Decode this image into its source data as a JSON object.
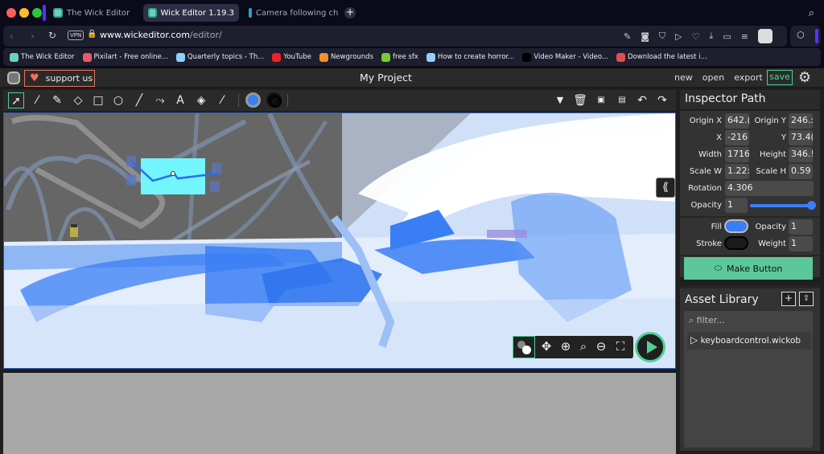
{
  "browser": {
    "tabs": [
      {
        "label": "The Wick Editor",
        "active": false
      },
      {
        "label": "Wick Editor 1.19.3",
        "active": true
      },
      {
        "label": "Camera following charac",
        "active": false
      }
    ],
    "new_tab": "+",
    "vpn_label": "VPN",
    "url_host": "www.wickeditor.com",
    "url_path": "/editor/",
    "bookmarks": [
      {
        "label": "The Wick Editor",
        "color": "#6ad0c0"
      },
      {
        "label": "Pixilart - Free online...",
        "color": "#e85a6a"
      },
      {
        "label": "Quarterly topics - Th...",
        "color": "#8fd0ff"
      },
      {
        "label": "YouTube",
        "color": "#e22"
      },
      {
        "label": "Newgrounds",
        "color": "#f0902a"
      },
      {
        "label": "free sfx",
        "color": "#7c3"
      },
      {
        "label": "How to create horror...",
        "color": "#8fd0ff"
      },
      {
        "label": "Video Maker - Video...",
        "color": "#000"
      },
      {
        "label": "Download the latest i...",
        "color": "#e05050"
      }
    ]
  },
  "editor": {
    "support_label": "support us",
    "project_title": "My Project",
    "menu": [
      "new",
      "open",
      "export"
    ],
    "save_label": "save",
    "accent": "#4fd195",
    "fill_color": "#3a7ef5",
    "stroke_color": "#000000",
    "tools": [
      {
        "name": "cursor",
        "glyph": "⬚"
      },
      {
        "name": "brush",
        "glyph": "🖌"
      },
      {
        "name": "pencil",
        "glyph": "✎"
      },
      {
        "name": "eraser",
        "glyph": "⌫"
      },
      {
        "name": "rectangle",
        "glyph": "□"
      },
      {
        "name": "ellipse",
        "glyph": "○"
      },
      {
        "name": "line",
        "glyph": "╱"
      },
      {
        "name": "path-cursor",
        "glyph": "⤳"
      },
      {
        "name": "text",
        "glyph": "A"
      },
      {
        "name": "fill-bucket",
        "glyph": "◈"
      },
      {
        "name": "eyedropper",
        "glyph": "⁄"
      }
    ],
    "right_tools": [
      {
        "name": "more-dropdown",
        "glyph": "▼"
      },
      {
        "name": "delete",
        "glyph": "🗑"
      },
      {
        "name": "copy",
        "glyph": "C"
      },
      {
        "name": "paste",
        "glyph": "P"
      },
      {
        "name": "undo",
        "glyph": "↶"
      },
      {
        "name": "redo",
        "glyph": "↷"
      }
    ],
    "collapse_glyph": "⟪",
    "canvas_controls": [
      {
        "name": "pan",
        "glyph": "✥"
      },
      {
        "name": "zoom-in",
        "glyph": "⊕"
      },
      {
        "name": "zoom",
        "glyph": "🔍"
      },
      {
        "name": "zoom-out",
        "glyph": "⊖"
      },
      {
        "name": "recenter",
        "glyph": "⛶"
      }
    ]
  },
  "inspector": {
    "title": "Inspector",
    "type": "Path",
    "origin_x_label": "Origin X",
    "origin_x": "642.(",
    "origin_y_label": "Origin Y",
    "origin_y": "246.:",
    "x_label": "X",
    "x": "-216",
    "y_label": "Y",
    "y": "73.4(",
    "width_label": "Width",
    "width": "1716",
    "height_label": "Height",
    "height": "346.!",
    "scale_w_label": "Scale W",
    "scale_w": "1.22:",
    "scale_h_label": "Scale H",
    "scale_h": "0.59",
    "rotation_label": "Rotation",
    "rotation": "4.306",
    "opacity_label": "Opacity",
    "opacity": "1",
    "opacity_slider": 1.0,
    "fill_label": "Fill",
    "fill_opacity_label": "Opacity",
    "fill_opacity": "1",
    "stroke_label": "Stroke",
    "weight_label": "Weight",
    "weight": "1",
    "make_button_label": "Make Button"
  },
  "assets": {
    "title": "Asset Library",
    "add": "+",
    "export": "⇪",
    "filter_placeholder": "filter...",
    "items": [
      {
        "name": "keyboardcontrol.wickob"
      }
    ]
  }
}
